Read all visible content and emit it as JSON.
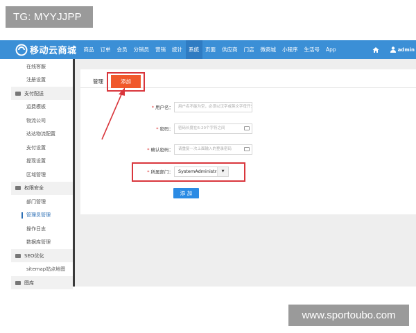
{
  "watermark_top": "TG: MYYJJPP",
  "watermark_bottom": "www.sportoubo.com",
  "logo": {
    "text": "移动云商城"
  },
  "nav": {
    "items": [
      "商品",
      "订单",
      "会员",
      "分销员",
      "营销",
      "统计",
      "系统",
      "页面",
      "供应商",
      "门店",
      "微商城",
      "小程序",
      "生活号",
      "App"
    ],
    "active": "系统",
    "user": "admin"
  },
  "sidebar": {
    "top_items": [
      "在线客服",
      "注册设置"
    ],
    "group_payment": "支付配送",
    "payment_items": [
      "运费模板",
      "物流公司",
      "达达物流配置",
      "支付设置",
      "提现设置",
      "区域管理"
    ],
    "group_security": "权限安全",
    "security_items": [
      "部门管理",
      "管理员管理",
      "操作日志",
      "数据库管理"
    ],
    "active_item": "管理员管理",
    "group_seo": "SEO优化",
    "seo_items": [
      "sitemap站点地图"
    ],
    "group_last": "图库"
  },
  "tabs": {
    "manage": "管理",
    "add": "添加"
  },
  "form": {
    "username_label": "用户名：",
    "username_placeholder": "用户名不能为空，必须以汉字或英文字母开头",
    "password_label": "密码：",
    "password_placeholder": "密码长度在6-20个字符之间",
    "confirm_label": "确认密码：",
    "confirm_placeholder": "请重复一次上面输入的登录密码",
    "dept_label": "所属部门：",
    "dept_value": "SystemAdministrator",
    "submit_label": "添 加"
  },
  "colors": {
    "nav_bg": "#3b8fd6",
    "add_tab": "#f0582b",
    "highlight": "#d9363c",
    "submit": "#2b8be4"
  }
}
